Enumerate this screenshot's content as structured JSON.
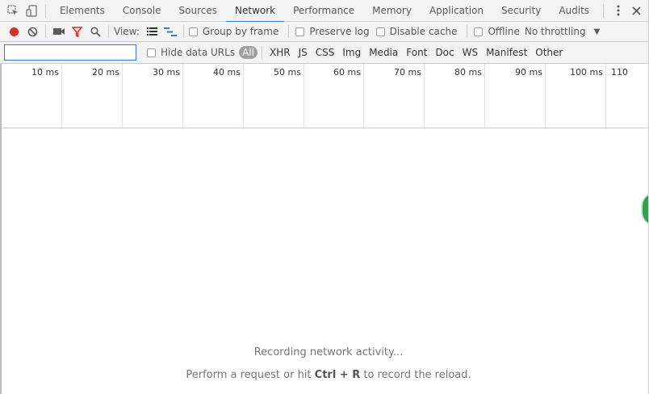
{
  "tabs": {
    "items": [
      "Elements",
      "Console",
      "Sources",
      "Network",
      "Performance",
      "Memory",
      "Application",
      "Security",
      "Audits"
    ],
    "active": "Network",
    "icons": [
      "inspect-element-icon",
      "device-toggle-icon",
      "more-vert-icon",
      "close-icon"
    ]
  },
  "toolbar": {
    "view_label": "View:",
    "group_by_frame": "Group by frame",
    "preserve_log": "Preserve log",
    "disable_cache": "Disable cache",
    "offline": "Offline",
    "throttling": "No throttling",
    "icons": [
      "record-icon",
      "clear-icon",
      "screenshot-icon",
      "filter-icon",
      "search-icon",
      "list-view-icon",
      "waterfall-view-icon"
    ],
    "record_color": "#d93025",
    "filter_color": "#d93025"
  },
  "filter": {
    "value": "",
    "hide_data_urls": "Hide data URLs",
    "types": [
      "All",
      "XHR",
      "JS",
      "CSS",
      "Img",
      "Media",
      "Font",
      "Doc",
      "WS",
      "Manifest",
      "Other"
    ],
    "selected": "All"
  },
  "timeline": {
    "ticks": [
      "10 ms",
      "20 ms",
      "30 ms",
      "40 ms",
      "50 ms",
      "60 ms",
      "70 ms",
      "80 ms",
      "90 ms",
      "100 ms",
      "110"
    ]
  },
  "empty_state": {
    "line1": "Recording network activity...",
    "line2_before": "Perform a request or hit",
    "line2_shortcut": "Ctrl + R",
    "line2_after": "to record the reload."
  },
  "accent_color": "#3879d9"
}
